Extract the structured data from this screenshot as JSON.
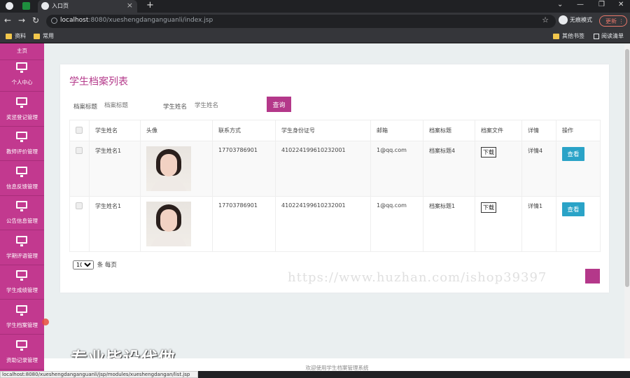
{
  "browser": {
    "tab_title": "入口页",
    "url_host": "localhost",
    "url_path": ":8080/xueshengdanganguanli/index.jsp",
    "incognito_label": "无痕模式",
    "update_label": "更新",
    "bookmarks": [
      "资料",
      "常用"
    ],
    "bookmarks_right": [
      "其他书签",
      "阅读清单"
    ]
  },
  "sidebar": {
    "items": [
      {
        "label": "主页"
      },
      {
        "label": "个人中心"
      },
      {
        "label": "奖惩登记管理"
      },
      {
        "label": "教师评价管理"
      },
      {
        "label": "信息反馈管理"
      },
      {
        "label": "公告信息管理"
      },
      {
        "label": "学期评语管理"
      },
      {
        "label": "学生成绩管理"
      },
      {
        "label": "学生档案管理"
      },
      {
        "label": "资助记录管理"
      }
    ]
  },
  "page": {
    "title": "学生档案列表",
    "filters": {
      "archive_title_label": "档案标题",
      "archive_title_placeholder": "档案标题",
      "student_name_label": "学生姓名",
      "student_name_placeholder": "学生姓名",
      "query_button": "查询"
    },
    "table": {
      "columns": [
        "学生姓名",
        "头像",
        "联系方式",
        "学生身份证号",
        "邮箱",
        "档案标题",
        "档案文件",
        "详情",
        "操作"
      ],
      "rows": [
        {
          "name": "学生姓名1",
          "phone": "17703786901",
          "id_card": "410224199610232001",
          "email": "1@qq.com",
          "archive_title": "档案标题4",
          "file": "下载",
          "detail": "详情4",
          "action": "查看"
        },
        {
          "name": "学生姓名1",
          "phone": "17703786901",
          "id_card": "410224199610232001",
          "email": "1@qq.com",
          "archive_title": "档案标题1",
          "file": "下载",
          "detail": "详情1",
          "action": "查看"
        }
      ]
    },
    "pager": {
      "page_size": "10",
      "suffix": "条 每页"
    },
    "footer": "欢迎使用学生档案管理系统"
  },
  "overlay": {
    "watermark_url": "https://www.huzhan.com/ishop39397",
    "watermark_text": "专业毕设代做",
    "status_url": "localhost:8080/xueshengdanganguanli/jsp/modules/xueshengdangan/list.jsp"
  },
  "colors": {
    "accent": "#c2398f",
    "title": "#b4388a",
    "view_button": "#2aa3c7"
  }
}
